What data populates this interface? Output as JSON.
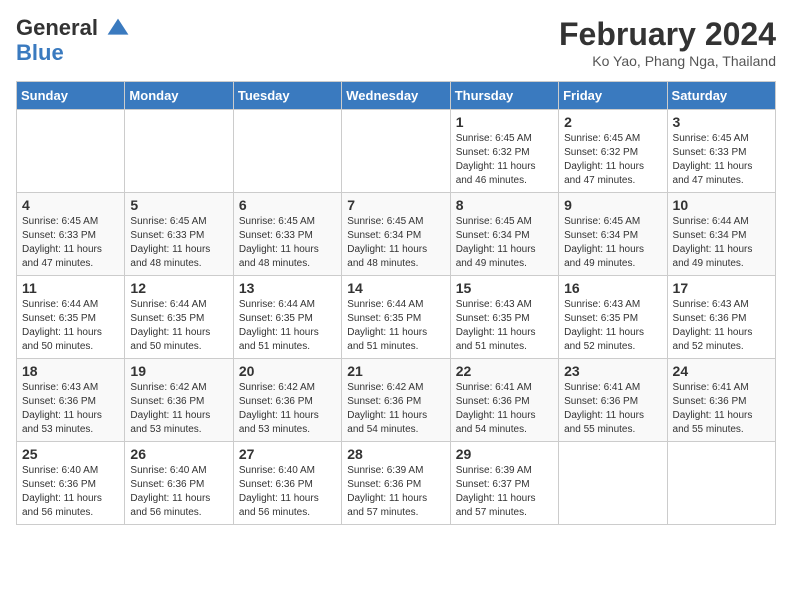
{
  "header": {
    "logo_line1": "General",
    "logo_line2": "Blue",
    "title": "February 2024",
    "subtitle": "Ko Yao, Phang Nga, Thailand"
  },
  "days_of_week": [
    "Sunday",
    "Monday",
    "Tuesday",
    "Wednesday",
    "Thursday",
    "Friday",
    "Saturday"
  ],
  "weeks": [
    [
      {
        "day": "",
        "info": ""
      },
      {
        "day": "",
        "info": ""
      },
      {
        "day": "",
        "info": ""
      },
      {
        "day": "",
        "info": ""
      },
      {
        "day": "1",
        "info": "Sunrise: 6:45 AM\nSunset: 6:32 PM\nDaylight: 11 hours and 46 minutes."
      },
      {
        "day": "2",
        "info": "Sunrise: 6:45 AM\nSunset: 6:32 PM\nDaylight: 11 hours and 47 minutes."
      },
      {
        "day": "3",
        "info": "Sunrise: 6:45 AM\nSunset: 6:33 PM\nDaylight: 11 hours and 47 minutes."
      }
    ],
    [
      {
        "day": "4",
        "info": "Sunrise: 6:45 AM\nSunset: 6:33 PM\nDaylight: 11 hours and 47 minutes."
      },
      {
        "day": "5",
        "info": "Sunrise: 6:45 AM\nSunset: 6:33 PM\nDaylight: 11 hours and 48 minutes."
      },
      {
        "day": "6",
        "info": "Sunrise: 6:45 AM\nSunset: 6:33 PM\nDaylight: 11 hours and 48 minutes."
      },
      {
        "day": "7",
        "info": "Sunrise: 6:45 AM\nSunset: 6:34 PM\nDaylight: 11 hours and 48 minutes."
      },
      {
        "day": "8",
        "info": "Sunrise: 6:45 AM\nSunset: 6:34 PM\nDaylight: 11 hours and 49 minutes."
      },
      {
        "day": "9",
        "info": "Sunrise: 6:45 AM\nSunset: 6:34 PM\nDaylight: 11 hours and 49 minutes."
      },
      {
        "day": "10",
        "info": "Sunrise: 6:44 AM\nSunset: 6:34 PM\nDaylight: 11 hours and 49 minutes."
      }
    ],
    [
      {
        "day": "11",
        "info": "Sunrise: 6:44 AM\nSunset: 6:35 PM\nDaylight: 11 hours and 50 minutes."
      },
      {
        "day": "12",
        "info": "Sunrise: 6:44 AM\nSunset: 6:35 PM\nDaylight: 11 hours and 50 minutes."
      },
      {
        "day": "13",
        "info": "Sunrise: 6:44 AM\nSunset: 6:35 PM\nDaylight: 11 hours and 51 minutes."
      },
      {
        "day": "14",
        "info": "Sunrise: 6:44 AM\nSunset: 6:35 PM\nDaylight: 11 hours and 51 minutes."
      },
      {
        "day": "15",
        "info": "Sunrise: 6:43 AM\nSunset: 6:35 PM\nDaylight: 11 hours and 51 minutes."
      },
      {
        "day": "16",
        "info": "Sunrise: 6:43 AM\nSunset: 6:35 PM\nDaylight: 11 hours and 52 minutes."
      },
      {
        "day": "17",
        "info": "Sunrise: 6:43 AM\nSunset: 6:36 PM\nDaylight: 11 hours and 52 minutes."
      }
    ],
    [
      {
        "day": "18",
        "info": "Sunrise: 6:43 AM\nSunset: 6:36 PM\nDaylight: 11 hours and 53 minutes."
      },
      {
        "day": "19",
        "info": "Sunrise: 6:42 AM\nSunset: 6:36 PM\nDaylight: 11 hours and 53 minutes."
      },
      {
        "day": "20",
        "info": "Sunrise: 6:42 AM\nSunset: 6:36 PM\nDaylight: 11 hours and 53 minutes."
      },
      {
        "day": "21",
        "info": "Sunrise: 6:42 AM\nSunset: 6:36 PM\nDaylight: 11 hours and 54 minutes."
      },
      {
        "day": "22",
        "info": "Sunrise: 6:41 AM\nSunset: 6:36 PM\nDaylight: 11 hours and 54 minutes."
      },
      {
        "day": "23",
        "info": "Sunrise: 6:41 AM\nSunset: 6:36 PM\nDaylight: 11 hours and 55 minutes."
      },
      {
        "day": "24",
        "info": "Sunrise: 6:41 AM\nSunset: 6:36 PM\nDaylight: 11 hours and 55 minutes."
      }
    ],
    [
      {
        "day": "25",
        "info": "Sunrise: 6:40 AM\nSunset: 6:36 PM\nDaylight: 11 hours and 56 minutes."
      },
      {
        "day": "26",
        "info": "Sunrise: 6:40 AM\nSunset: 6:36 PM\nDaylight: 11 hours and 56 minutes."
      },
      {
        "day": "27",
        "info": "Sunrise: 6:40 AM\nSunset: 6:36 PM\nDaylight: 11 hours and 56 minutes."
      },
      {
        "day": "28",
        "info": "Sunrise: 6:39 AM\nSunset: 6:36 PM\nDaylight: 11 hours and 57 minutes."
      },
      {
        "day": "29",
        "info": "Sunrise: 6:39 AM\nSunset: 6:37 PM\nDaylight: 11 hours and 57 minutes."
      },
      {
        "day": "",
        "info": ""
      },
      {
        "day": "",
        "info": ""
      }
    ]
  ]
}
